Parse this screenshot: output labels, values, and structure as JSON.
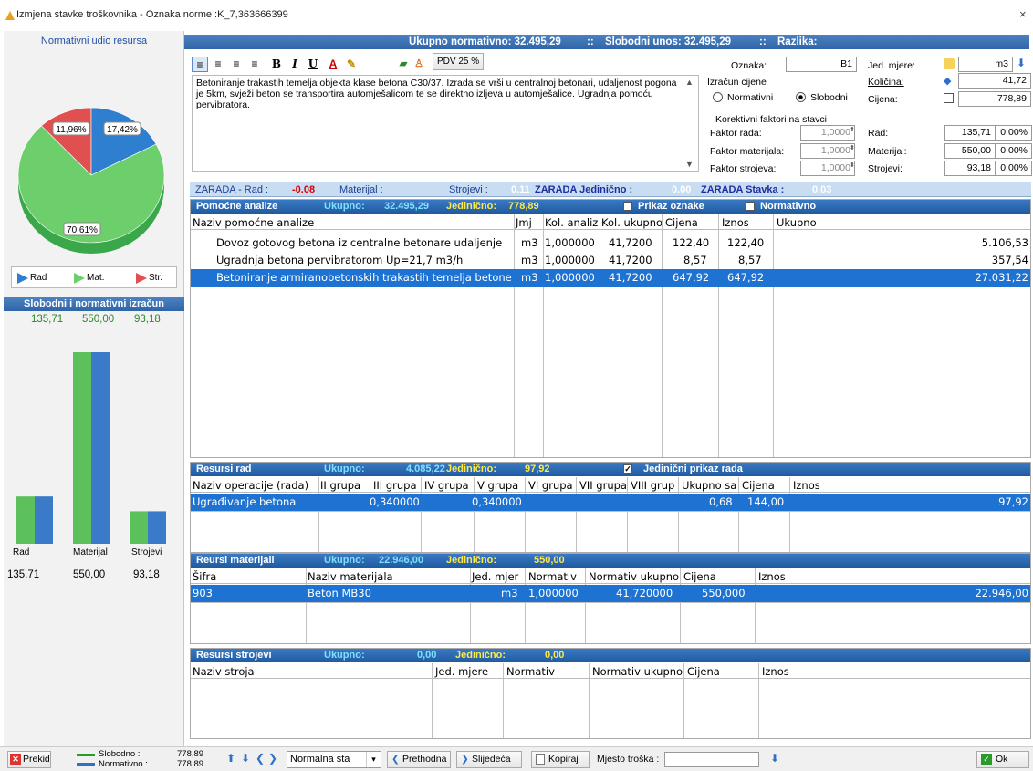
{
  "window": {
    "title": "Izmjena stavke troškovnika - Oznaka norme :K_7,363666399",
    "close": "×"
  },
  "left_panel": {
    "chart_title": "Normativni udio resursa",
    "pie": {
      "labels": [
        "11,96%",
        "17,42%",
        "70,61%"
      ]
    },
    "legend": {
      "rad": "Rad",
      "mat": "Mat.",
      "str": "Str."
    },
    "section_title": "Slobodni i normativni izračun",
    "values": [
      "135,71",
      "550,00",
      "93,18"
    ],
    "bar_labels": [
      "Rad",
      "Materijal",
      "Strojevi"
    ],
    "bar_values": [
      "135,71",
      "550,00",
      "93,18"
    ]
  },
  "chart_data": {
    "type": "bar",
    "title": "Slobodni i normativni izračun",
    "categories": [
      "Rad",
      "Materijal",
      "Strojevi"
    ],
    "series": [
      {
        "name": "Slobodno",
        "values": [
          135.71,
          550.0,
          93.18
        ]
      },
      {
        "name": "Normativno",
        "values": [
          135.71,
          550.0,
          93.18
        ]
      }
    ],
    "pie": {
      "title": "Normativni udio resursa",
      "slices": [
        {
          "label": "Rad",
          "value": 17.42
        },
        {
          "label": "Mat.",
          "value": 70.61
        },
        {
          "label": "Str.",
          "value": 11.96
        }
      ]
    },
    "colors": {
      "rad": "#2f7fd0",
      "mat": "#6ccf6c",
      "str": "#e05050"
    }
  },
  "top_bar": {
    "ukupno_normativno_label": "Ukupno normativno: 32.495,29",
    "sep": "::",
    "slobodni_unos_label": "Slobodni unos: 32.495,29",
    "razlika_label": "Razlika:"
  },
  "toolbar": {
    "pdv_label": "PDV 25 %"
  },
  "description": "Betoniranje trakastih temelja objekta klase betona C30/37. Izrada se vrši u centralnoj betonari, udaljenost pogona je 5km, svježi beton se transportira automješalicom te se direktno izljeva u automješalice. Ugradnja pomoću pervibratora.",
  "form": {
    "oznaka_label": "Oznaka:",
    "oznaka_value": "B1",
    "jed_mjere_label": "Jed. mjere:",
    "jed_mjere_value": "m3",
    "izracun_label": "Izračun cijene",
    "normativni_label": "Normativni",
    "slobodni_label": "Slobodni",
    "kolicina_label": "Količina:",
    "kolicina_value": "41,72",
    "cijena_label": "Cijena:",
    "cijena_value": "778,89",
    "korektivni_label": "Korektivni faktori na stavci",
    "faktor_rada_label": "Faktor rada:",
    "faktor_rada_value": "1,0000",
    "faktor_mat_label": "Faktor materijala:",
    "faktor_mat_value": "1,0000",
    "faktor_str_label": "Faktor strojeva:",
    "faktor_str_value": "1,0000",
    "rad_label": "Rad:",
    "rad_value": "135,71",
    "rad_pct": "0,00%",
    "mat_label": "Materijal:",
    "mat_value": "550,00",
    "mat_pct": "0,00%",
    "str_label": "Strojevi:",
    "str_value": "93,18",
    "str_pct": "0,00%"
  },
  "zarada": {
    "rad_label": "ZARADA - Rad :",
    "rad_value": "-0.08",
    "mat_label": "Materijal :",
    "str_label": "Strojevi :",
    "str_value": "0.11",
    "jed_label": "ZARADA Jedinično :",
    "jed_value": "0.00",
    "stavka_label": "ZARADA Stavka :",
    "stavka_value": "0.03"
  },
  "pomocne": {
    "title": "Pomoćne analize",
    "ukupno_label": "Ukupno:",
    "ukupno_value": "32.495,29",
    "jedinicno_label": "Jedinično:",
    "jedinicno_value": "778,89",
    "prikaz_label": "Prikaz oznake",
    "normativno_label": "Normativno",
    "columns": [
      "Naziv pomoćne analize",
      "Jmj",
      "Kol. analiz",
      "Kol. ukupno",
      "Cijena",
      "Iznos",
      "Ukupno"
    ],
    "rows": [
      [
        "Dovoz gotovog betona iz centralne betonare udaljenje",
        "m3",
        "1,000000",
        "41,7200",
        "122,40",
        "122,40",
        "5.106,53"
      ],
      [
        "Ugradnja betona pervibratorom Up=21,7 m3/h",
        "m3",
        "1,000000",
        "41,7200",
        "8,57",
        "8,57",
        "357,54"
      ],
      [
        "Betoniranje armiranobetonskih trakastih temelja betone",
        "m3",
        "1,000000",
        "41,7200",
        "647,92",
        "647,92",
        "27.031,22"
      ]
    ]
  },
  "resursi_rad": {
    "title": "Resursi rad",
    "ukupno_label": "Ukupno:",
    "ukupno_value": "4.085,22",
    "jedinicno_label": "Jedinično:",
    "jedinicno_value": "97,92",
    "prikaz_label": "Jedinični prikaz rada",
    "columns": [
      "Naziv operacije (rada)",
      "II grupa",
      "III grupa",
      "IV grupa",
      "V grupa",
      "VI grupa",
      "VII grupa",
      "VIII grup",
      "Ukupno sa",
      "Cijena",
      "Iznos"
    ],
    "row": [
      "Ugrađivanje betona",
      "0,340000",
      "0,340000",
      "0,68",
      "144,00",
      "97,92"
    ]
  },
  "resursi_mat": {
    "title": "Reursi materijali",
    "ukupno_label": "Ukupno:",
    "ukupno_value": "22.946,00",
    "jedinicno_label": "Jedinično:",
    "jedinicno_value": "550,00",
    "columns": [
      "Šifra",
      "Naziv materijala",
      "Jed. mjer",
      "Normativ",
      "Normativ ukupno",
      "Cijena",
      "Iznos"
    ],
    "row": [
      "903",
      "Beton MB30",
      "m3",
      "1,000000",
      "41,720000",
      "550,000",
      "22.946,00"
    ]
  },
  "resursi_str": {
    "title": "Resursi strojevi",
    "ukupno_label": "Ukupno:",
    "ukupno_value": "0,00",
    "jedinicno_label": "Jedinično:",
    "jedinicno_value": "0,00",
    "columns": [
      "Naziv stroja",
      "Jed. mjere",
      "Normativ",
      "Normativ ukupno",
      "Cijena",
      "Iznos"
    ]
  },
  "bottom": {
    "prekid": "Prekid",
    "slobodno_label": "Slobodno :",
    "normativno_label": "Normativno :",
    "slobodno_value": "778,89",
    "normativno_value": "778,89",
    "mode_value": "Normalna sta",
    "prethodna": "Prethodna",
    "sljedeca": "Slijedeća",
    "kopiraj": "Kopiraj",
    "mjesto_label": "Mjesto troška :",
    "ok": "Ok"
  }
}
